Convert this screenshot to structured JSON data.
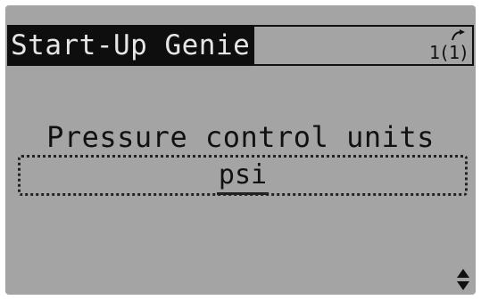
{
  "header": {
    "title": "Start-Up Genie",
    "page_indicator": "1(1)"
  },
  "parameter": {
    "label": "Pressure control units",
    "value": "psi"
  },
  "icons": {
    "page_arrow": "curved-arrow-icon",
    "scroll": "up-down-scroll-icon"
  },
  "colors": {
    "lcd_background": "#a4a4a4",
    "inverse_background": "#0e0e0e",
    "inverse_text": "#e6e6e6",
    "text": "#111111"
  }
}
